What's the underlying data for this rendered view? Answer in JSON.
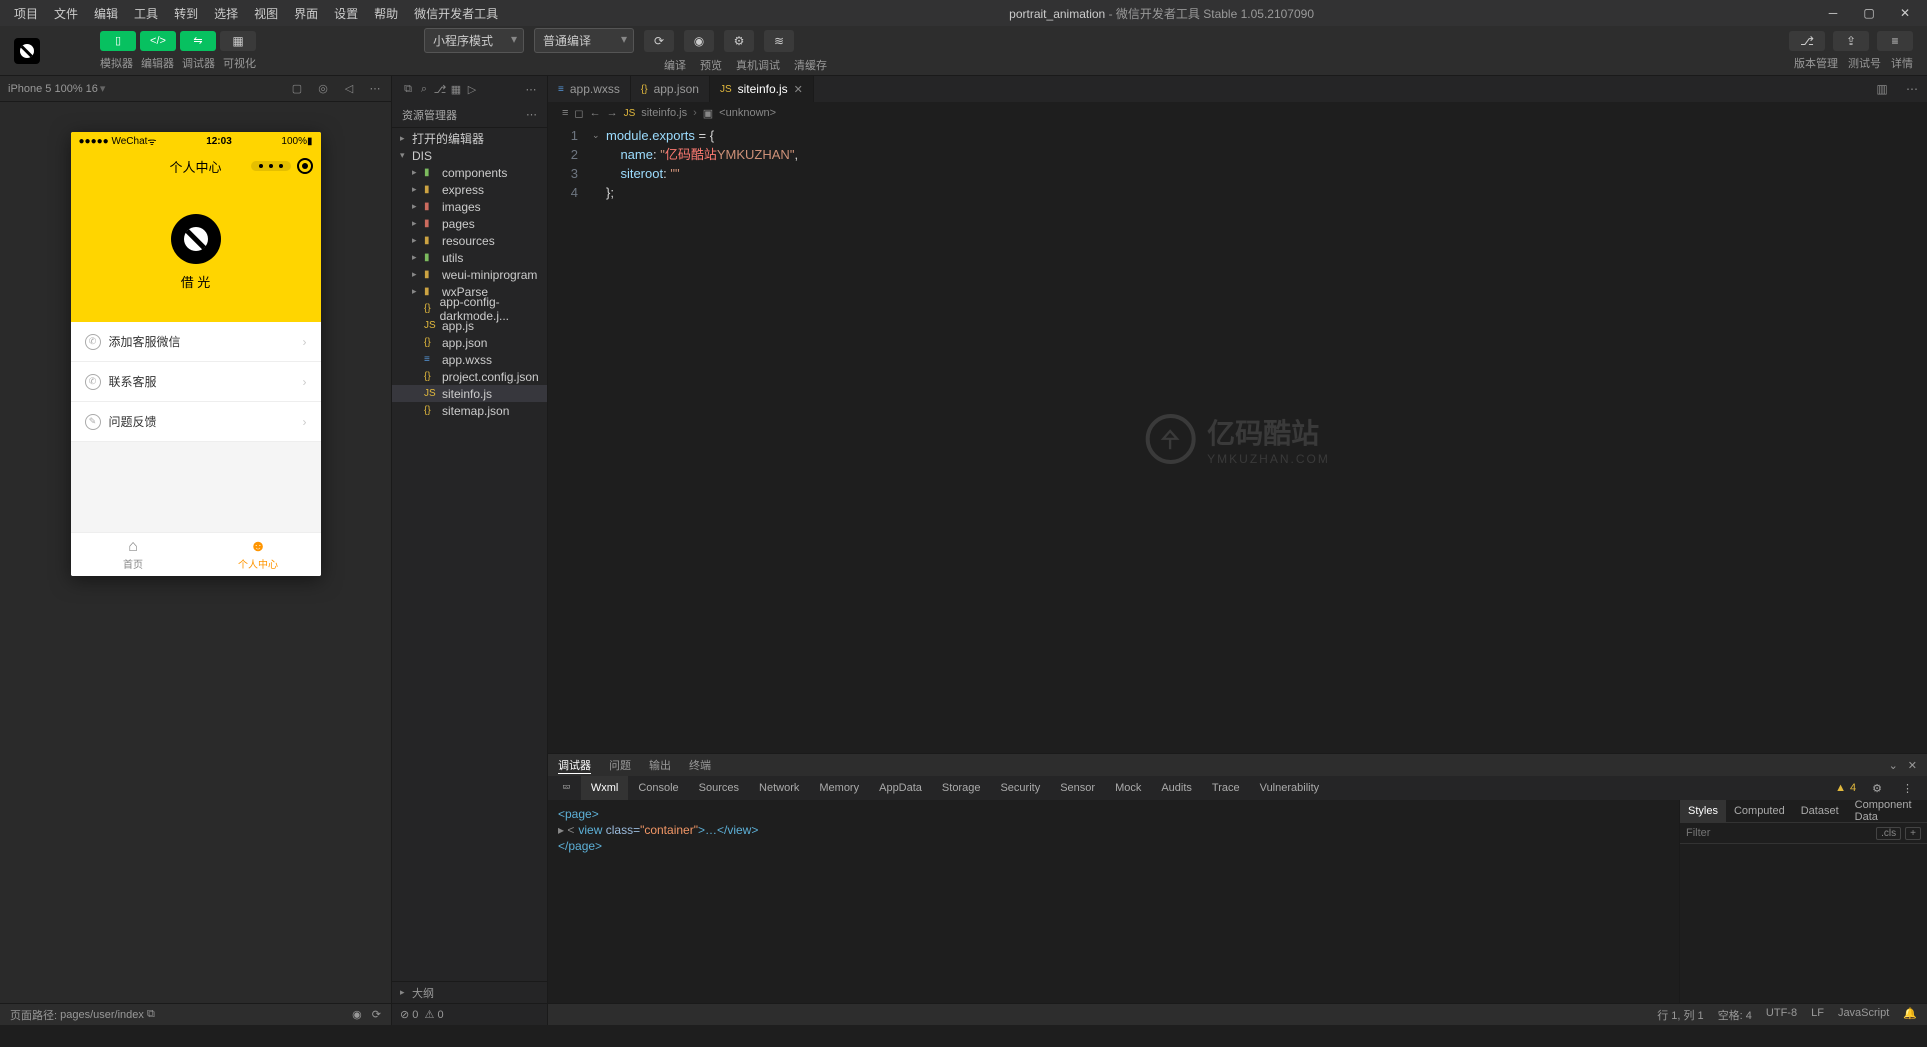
{
  "menu": [
    "项目",
    "文件",
    "编辑",
    "工具",
    "转到",
    "选择",
    "视图",
    "界面",
    "设置",
    "帮助",
    "微信开发者工具"
  ],
  "title": {
    "project": "portrait_animation",
    "suffix": " - 微信开发者工具 Stable 1.05.2107090"
  },
  "toolbar": {
    "labels": {
      "simulator": "模拟器",
      "editor": "编辑器",
      "debugger": "调试器",
      "visual": "可视化"
    },
    "mode": "小程序模式",
    "compile": "普通编译",
    "actions": {
      "compile": "编译",
      "preview": "预览",
      "real": "真机调试",
      "clear": "清缓存"
    },
    "right": {
      "version": "版本管理",
      "test": "测试号",
      "detail": "详情"
    }
  },
  "simulator": {
    "device": "iPhone 5 100% 16",
    "status": {
      "left": "●●●●● WeChat",
      "time": "12:03",
      "batt": "100%"
    },
    "nav_title": "个人中心",
    "hero_name": "借 光",
    "items": [
      "添加客服微信",
      "联系客服",
      "问题反馈"
    ],
    "tabs": {
      "home": "首页",
      "me": "个人中心"
    }
  },
  "explorer": {
    "title": "资源管理器",
    "open_editors": "打开的编辑器",
    "root": "DIS",
    "folders": [
      "components",
      "express",
      "images",
      "pages",
      "resources",
      "utils",
      "weui-miniprogram",
      "wxParse"
    ],
    "files": [
      "app-config-darkmode.j...",
      "app.js",
      "app.json",
      "app.wxss",
      "project.config.json",
      "siteinfo.js",
      "sitemap.json"
    ],
    "outline": "大纲"
  },
  "tabs": [
    {
      "name": "app.wxss",
      "icon_class": "file-wxss"
    },
    {
      "name": "app.json",
      "icon_class": "file-json"
    },
    {
      "name": "siteinfo.js",
      "icon_class": "file-js",
      "active": true
    }
  ],
  "breadcrumb": {
    "file": "siteinfo.js",
    "symbol": "<unknown>"
  },
  "code": {
    "l1a": "module",
    "l1b": ".exports",
    "l1c": " = {",
    "l2a": "name",
    "l2b": ": ",
    "l2c": "\"",
    "l2d": "亿码酷站",
    "l2e": "YMKUZHAN",
    "l2f": "\"",
    "l2g": ",",
    "l3a": "siteroot",
    "l3b": ": ",
    "l3c": "\"\"",
    "l4": "};"
  },
  "watermark": {
    "cn": "亿码酷站",
    "en": "YMKUZHAN.COM"
  },
  "devtools": {
    "tabs1": [
      "调试器",
      "问题",
      "输出",
      "终端"
    ],
    "tabs2": [
      "Wxml",
      "Console",
      "Sources",
      "Network",
      "Memory",
      "AppData",
      "Storage",
      "Security",
      "Sensor",
      "Mock",
      "Audits",
      "Trace",
      "Vulnerability"
    ],
    "warn_count": "4",
    "dom": {
      "l1": "<page>",
      "l2a": "▸ <",
      "l2b": "view",
      "l2c": " class=",
      "l2d": "\"container\"",
      "l2e": ">…</",
      "l2f": "view",
      "l2g": ">",
      "l3": "</page>"
    },
    "style_tabs": [
      "Styles",
      "Computed",
      "Dataset",
      "Component Data"
    ],
    "filter_placeholder": "Filter",
    "cls": ".cls"
  },
  "left_footer": {
    "path_label": "页面路径:",
    "path": "pages/user/index"
  },
  "exp_status": {
    "err": "0",
    "warn": "0"
  },
  "statusbar": {
    "line": "行 1, 列 1",
    "spaces": "空格: 4",
    "enc": "UTF-8",
    "eol": "LF",
    "lang": "JavaScript"
  }
}
